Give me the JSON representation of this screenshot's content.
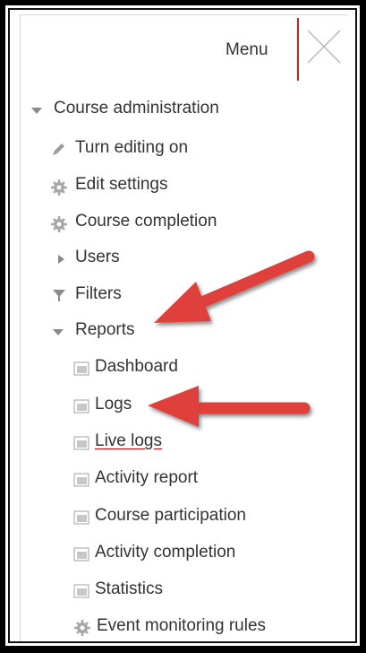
{
  "header": {
    "menu_label": "Menu",
    "close_icon": "close-icon"
  },
  "menu": {
    "course_admin": "Course administration",
    "turn_editing": "Turn editing on",
    "edit_settings": "Edit settings",
    "course_completion": "Course completion",
    "users": "Users",
    "filters": "Filters",
    "reports": "Reports",
    "reports_items": [
      "Dashboard",
      "Logs",
      "Live logs",
      "Activity report",
      "Course participation",
      "Activity completion",
      "Statistics"
    ],
    "event_monitoring": "Event monitoring rules"
  },
  "colors": {
    "arrow": "#e0413a",
    "divider": "#cc2222"
  }
}
